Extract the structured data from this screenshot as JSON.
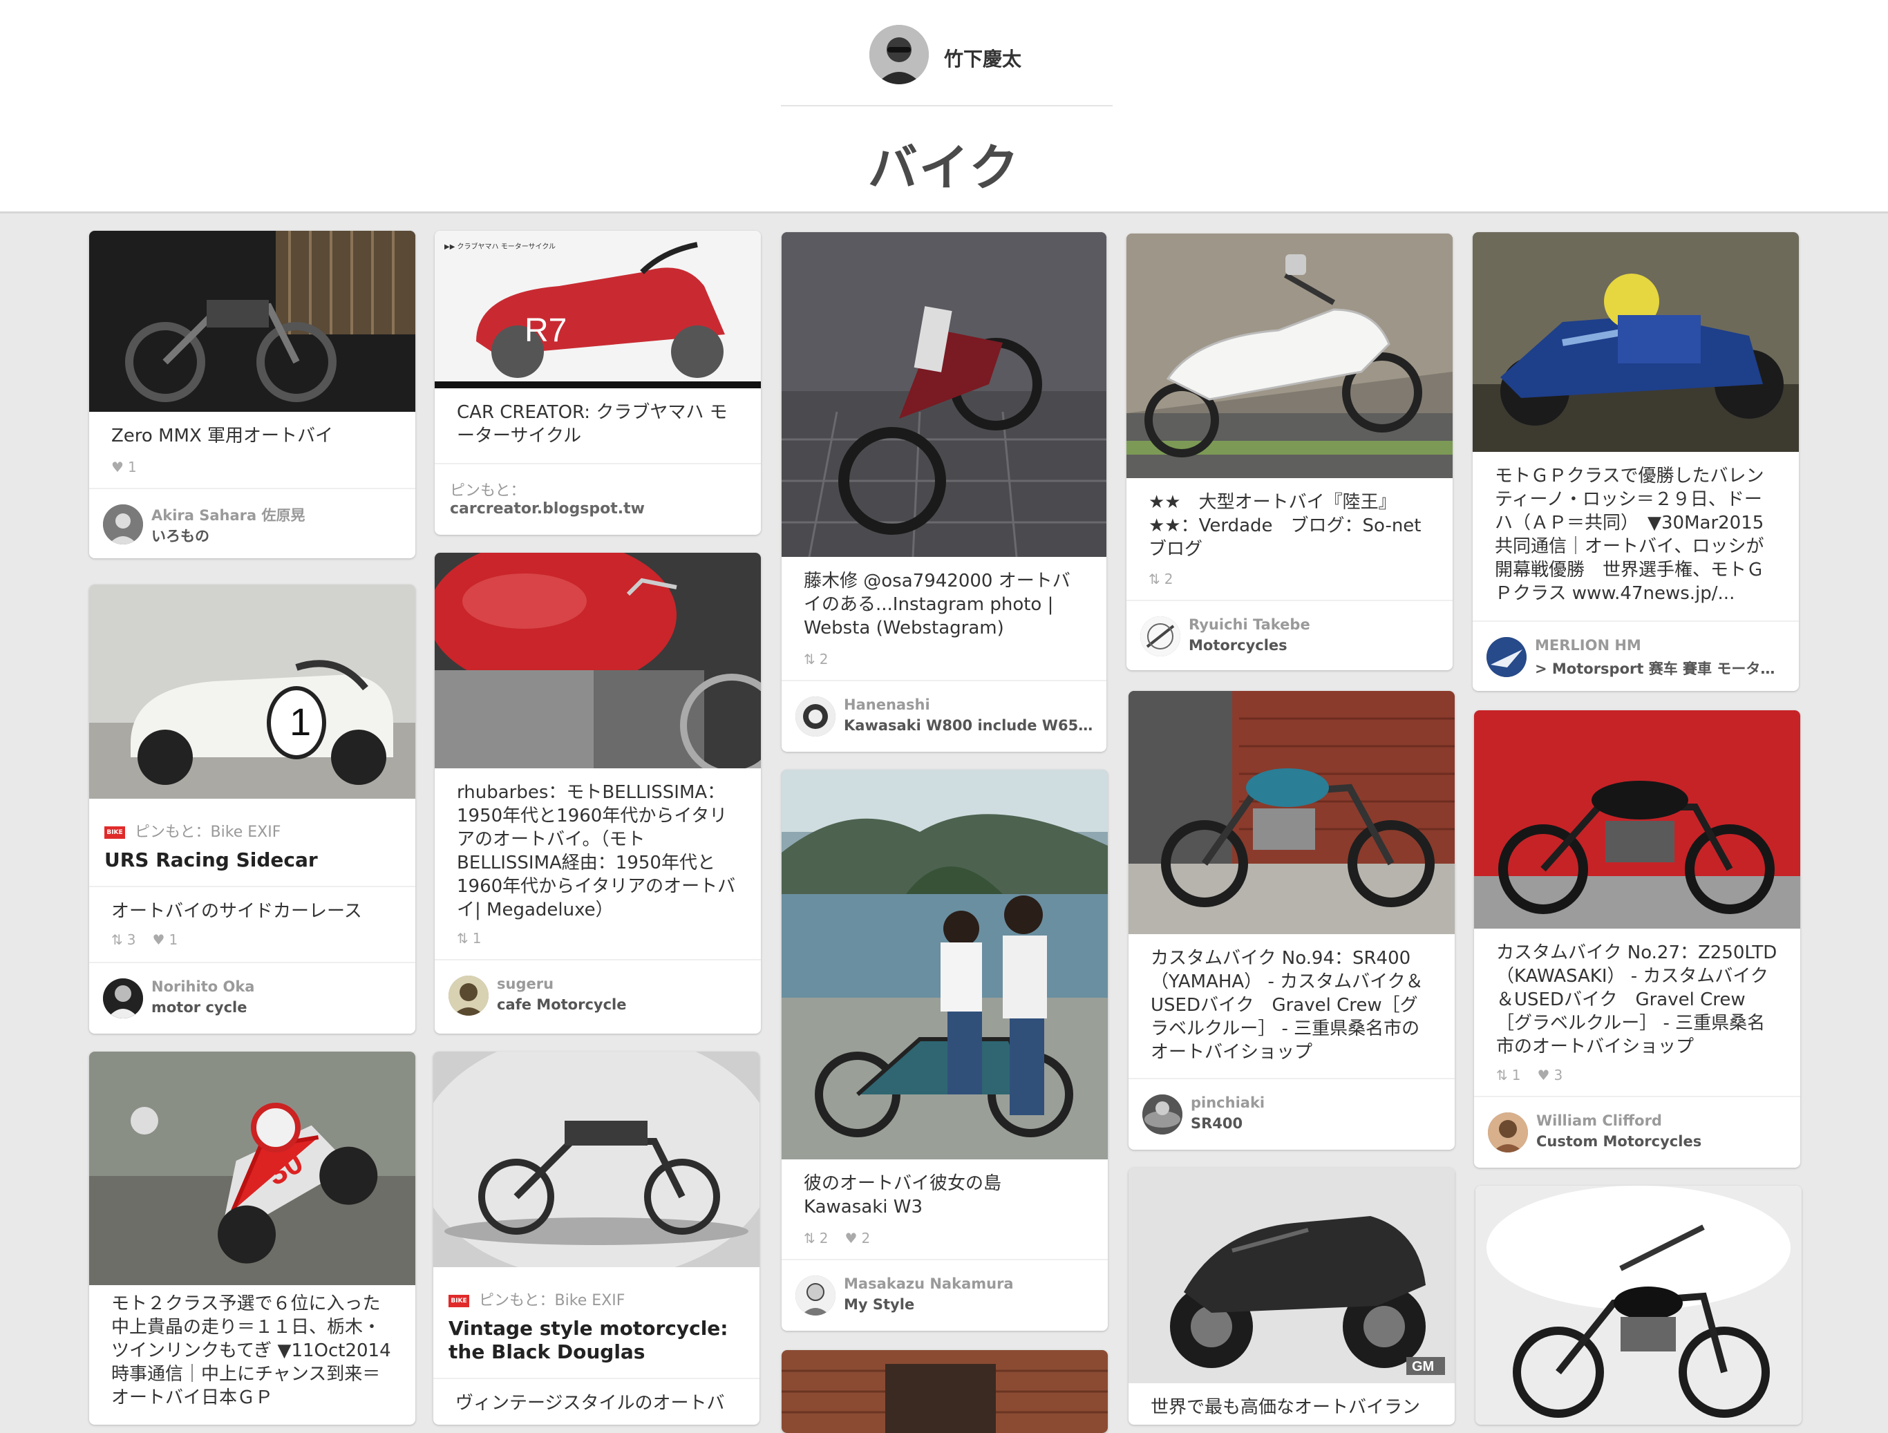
{
  "header": {
    "owner_name": "竹下慶太",
    "board_title": "バイク"
  },
  "icons": {
    "repin": "pin-icon",
    "like": "heart-icon"
  },
  "pins": [
    {
      "desc": "Zero MMX 軍用オートバイ",
      "likes": "1",
      "pinner": "Akira Sahara 佐原晃",
      "board": "いろもの"
    },
    {
      "desc": "CAR CREATOR: クラブヤマハ モーターサイクル",
      "image_caption": "▶▶ クラブヤマハ モーターサイクル",
      "source_label": "ピンもと：",
      "source_domain": "carcreator.blogspot.tw"
    },
    {
      "desc": "藤木修 @osa7942000 オートバイのある...Instagram photo | Websta (Webstagram)",
      "repins": "2",
      "pinner": "Hanenashi",
      "board": "Kawasaki W800 include W650 a..."
    },
    {
      "desc": "★★　大型オートバイ『陸王』★★：Verdade　ブログ：So-net ブログ",
      "repins": "2",
      "pinner": "Ryuichi Takebe",
      "board": "Motorcycles"
    },
    {
      "desc": "モトＧＰクラスで優勝したバレンティーノ・ロッシ＝２９日、ドーハ（ＡＰ＝共同）　▼30Mar2015 共同通信｜オートバイ、ロッシが開幕戦優勝　世界選手権、モトＧＰクラス www.47news.jp/...",
      "pinner": "MERLION HM",
      "board": "> Motorsport 赛车 賽車 モータース..."
    },
    {
      "source_label": "ピンもと：Bike EXIF",
      "title": "URS Racing Sidecar",
      "desc": "オートバイのサイドカーレース",
      "repins": "3",
      "likes": "1",
      "pinner": "Norihito Oka",
      "board": "motor cycle"
    },
    {
      "desc": "rhubarbes：モトBELLISSIMA：1950年代と1960年代からイタリアのオートバイ。（モトBELLISSIMA経由：1950年代と1960年代からイタリアのオートバイ| Megadeluxe）",
      "repins": "1",
      "pinner": "sugeru",
      "board": "cafe Motorcycle"
    },
    {
      "desc": "彼のオートバイ彼女の島 Kawasaki W3",
      "repins": "2",
      "likes": "2",
      "pinner": "Masakazu Nakamura",
      "board": "My Style"
    },
    {
      "desc": "カスタムバイク No.94：SR400（YAMAHA） - カスタムバイク＆USEDバイク　Gravel Crew［グラベルクルー］ - 三重県桑名市のオートバイショップ",
      "pinner": "pinchiaki",
      "board": "SR400"
    },
    {
      "desc": "カスタムバイク No.27：Z250LTD（KAWASAKI） - カスタムバイク＆USEDバイク　Gravel Crew［グラベルクルー］ - 三重県桑名市のオートバイショップ",
      "repins": "1",
      "likes": "3",
      "pinner": "William Clifford",
      "board": "Custom Motorcycles"
    },
    {
      "desc": "モト２クラス予選で６位に入った中上貴晶の走り＝１１日、栃木・ツインリンクもてぎ ▼11Oct2014時事通信｜中上にチャンス到来＝オートバイ日本ＧＰ"
    },
    {
      "source_label": "ピンもと：Bike EXIF",
      "title": "Vintage style motorcycle: the Black Douglas",
      "desc": "ヴィンテージスタイルのオートバ"
    },
    {
      "desc": "世界で最も高価なオートバイラン",
      "image_badge": "GM"
    }
  ]
}
